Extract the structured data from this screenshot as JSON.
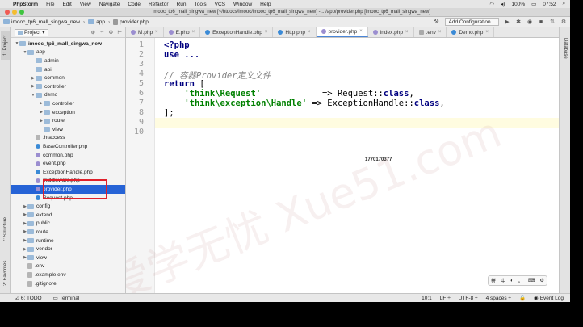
{
  "menubar": {
    "apple_icon": "apple-icon",
    "app_name": "PhpStorm",
    "items": [
      "File",
      "Edit",
      "View",
      "Navigate",
      "Code",
      "Refactor",
      "Run",
      "Tools",
      "VCS",
      "Window",
      "Help"
    ],
    "battery": "100%",
    "time": "07:52"
  },
  "window": {
    "title": "imooc_tp6_mall_singwa_new [~/htdocs/imooc/imooc_tp6_mall_singwa_new] - .../app/provider.php [imooc_tp6_mall_singwa_new]"
  },
  "navbar": {
    "crumbs": [
      "imooc_tp6_mall_singwa_new",
      "app",
      "provider.php"
    ],
    "run_config": "Add Configuration..."
  },
  "side_tabs": {
    "project": "1: Project",
    "structure": "7: Structure",
    "favorites": "2: Favorites",
    "database": "Database"
  },
  "project_panel": {
    "selector": "Project",
    "tree": [
      {
        "label": "imooc_tp6_mall_singwa_new",
        "type": "folder",
        "depth": 0,
        "expanded": true,
        "bold": true
      },
      {
        "label": "app",
        "type": "folder",
        "depth": 1,
        "expanded": true
      },
      {
        "label": "admin",
        "type": "folder",
        "depth": 2
      },
      {
        "label": "api",
        "type": "folder",
        "depth": 2
      },
      {
        "label": "common",
        "type": "folder",
        "depth": 2,
        "collapsed": true
      },
      {
        "label": "controller",
        "type": "folder",
        "depth": 2,
        "collapsed": true
      },
      {
        "label": "demo",
        "type": "folder",
        "depth": 2,
        "expanded": true
      },
      {
        "label": "controller",
        "type": "folder",
        "depth": 3,
        "collapsed": true
      },
      {
        "label": "exception",
        "type": "folder",
        "depth": 3,
        "collapsed": true
      },
      {
        "label": "route",
        "type": "folder",
        "depth": 3,
        "collapsed": true
      },
      {
        "label": "view",
        "type": "folder",
        "depth": 3
      },
      {
        "label": ".htaccess",
        "type": "txt",
        "depth": 2
      },
      {
        "label": "BaseController.php",
        "type": "cls",
        "depth": 2
      },
      {
        "label": "common.php",
        "type": "php",
        "depth": 2
      },
      {
        "label": "event.php",
        "type": "php",
        "depth": 2
      },
      {
        "label": "ExceptionHandle.php",
        "type": "cls",
        "depth": 2
      },
      {
        "label": "middleware.php",
        "type": "php",
        "depth": 2
      },
      {
        "label": "provider.php",
        "type": "php",
        "depth": 2,
        "selected": true
      },
      {
        "label": "Request.php",
        "type": "cls",
        "depth": 2
      },
      {
        "label": "config",
        "type": "folder",
        "depth": 1,
        "collapsed": true
      },
      {
        "label": "extend",
        "type": "folder",
        "depth": 1,
        "collapsed": true
      },
      {
        "label": "public",
        "type": "folder",
        "depth": 1,
        "collapsed": true
      },
      {
        "label": "route",
        "type": "folder",
        "depth": 1,
        "collapsed": true
      },
      {
        "label": "runtime",
        "type": "folder",
        "depth": 1,
        "collapsed": true
      },
      {
        "label": "vendor",
        "type": "folder",
        "depth": 1,
        "collapsed": true
      },
      {
        "label": "view",
        "type": "folder",
        "depth": 1,
        "collapsed": true
      },
      {
        "label": ".env",
        "type": "txt",
        "depth": 1
      },
      {
        "label": ".example.env",
        "type": "txt",
        "depth": 1
      },
      {
        "label": ".gitignore",
        "type": "txt",
        "depth": 1
      }
    ]
  },
  "tabs": [
    {
      "label": "M.php",
      "icon": "php"
    },
    {
      "label": "E.php",
      "icon": "php"
    },
    {
      "label": "ExceptionHandle.php",
      "icon": "cls"
    },
    {
      "label": "Http.php",
      "icon": "cls"
    },
    {
      "label": "provider.php",
      "icon": "php",
      "active": true
    },
    {
      "label": "index.php",
      "icon": "php"
    },
    {
      "label": ".env",
      "icon": "txt"
    },
    {
      "label": "Demo.php",
      "icon": "cls"
    }
  ],
  "editor": {
    "line_numbers": [
      "1",
      "2",
      "3",
      "4",
      "5",
      "6",
      "7",
      "8",
      "9",
      "10"
    ],
    "lines": {
      "l1": "<?php",
      "l2": "use ...",
      "l3": "",
      "l4": "// 容器Provider定义文件",
      "l5_kw": "return",
      "l5_rest": " [",
      "l6_str": "'think\\Request'",
      "l6_rest": "            => Request::",
      "l6_kw": "class",
      "l6_end": ",",
      "l7_str": "'think\\exception\\Handle'",
      "l7_rest": " => ExceptionHandle::",
      "l7_kw": "class",
      "l7_end": ",",
      "l8": "];",
      "l9": "",
      "l10": ""
    },
    "overlay_id": "1770170377",
    "watermark": "爱学无忧 Xue51.com"
  },
  "ime_bar": {
    "items": [
      "拼",
      "中",
      "◐",
      "。",
      "⌨",
      "⚙"
    ]
  },
  "statusbar": {
    "todo": "6: TODO",
    "terminal": "Terminal",
    "position": "10:1",
    "line_sep": "LF ÷",
    "encoding": "UTF-8 ÷",
    "indent": "4 spaces ÷",
    "event_log": "Event Log"
  },
  "colors": {
    "selection": "#2663d6",
    "red_box": "#e0202a",
    "keyword": "#000080",
    "string": "#008000",
    "comment": "#808080"
  }
}
